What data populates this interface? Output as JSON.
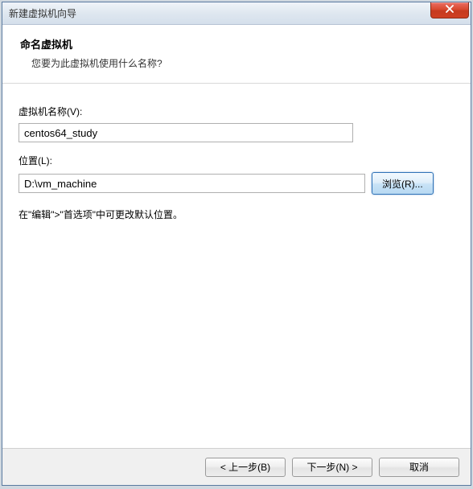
{
  "window": {
    "title": "新建虚拟机向导"
  },
  "header": {
    "title": "命名虚拟机",
    "subtitle": "您要为此虚拟机使用什么名称?"
  },
  "fields": {
    "name_label": "虚拟机名称(V):",
    "name_value": "centos64_study",
    "location_label": "位置(L):",
    "location_value": "D:\\vm_machine",
    "browse_label": "浏览(R)..."
  },
  "hint": "在\"编辑\">\"首选项\"中可更改默认位置。",
  "footer": {
    "back": "< 上一步(B)",
    "next": "下一步(N) >",
    "cancel": "取消"
  }
}
